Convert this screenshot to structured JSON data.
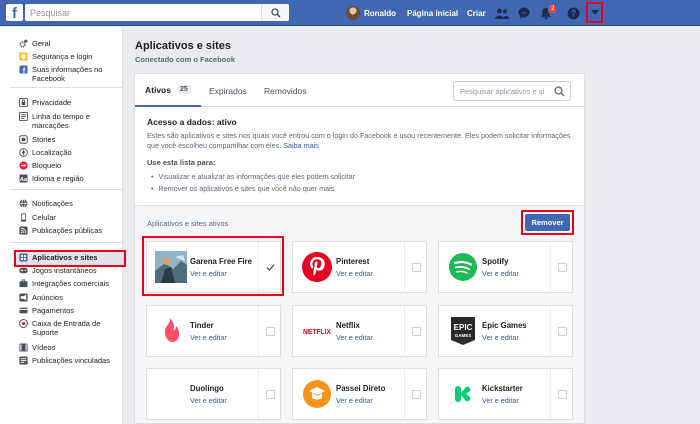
{
  "header": {
    "logo": "f",
    "search_placeholder": "Pesquisar",
    "user_name": "Ronaldo",
    "home": "Página inicial",
    "create": "Criar",
    "notification_count": "2"
  },
  "sidebar": {
    "groups": [
      [
        {
          "label": "Geral",
          "icon": "gear-icon"
        },
        {
          "label": "Segurança e login",
          "icon": "shield-icon"
        },
        {
          "label": "Suas informações no Facebook",
          "icon": "facebook-icon"
        }
      ],
      [
        {
          "label": "Privacidade",
          "icon": "lock-icon"
        },
        {
          "label": "Linha do tempo e marcações",
          "icon": "timeline-icon"
        },
        {
          "label": "Stories",
          "icon": "stories-icon"
        },
        {
          "label": "Localização",
          "icon": "location-icon"
        },
        {
          "label": "Bloqueio",
          "icon": "block-icon"
        },
        {
          "label": "Idioma e região",
          "icon": "language-icon"
        }
      ],
      [
        {
          "label": "Notificações",
          "icon": "globe-icon"
        },
        {
          "label": "Celular",
          "icon": "phone-icon"
        },
        {
          "label": "Publicações públicas",
          "icon": "rss-icon"
        }
      ],
      [
        {
          "label": "Aplicativos e sites",
          "icon": "apps-icon"
        },
        {
          "label": "Jogos instantâneos",
          "icon": "games-icon"
        },
        {
          "label": "Integrações comerciais",
          "icon": "business-icon"
        },
        {
          "label": "Anúncios",
          "icon": "ads-icon"
        },
        {
          "label": "Pagamentos",
          "icon": "payment-icon"
        },
        {
          "label": "Caixa de Entrada de Suporte",
          "icon": "support-icon"
        },
        {
          "label": "Vídeos",
          "icon": "video-icon"
        },
        {
          "label": "Publicações vinculadas",
          "icon": "linked-icon"
        }
      ]
    ]
  },
  "main": {
    "title": "Aplicativos e sites",
    "subtitle": "Conectado com o Facebook",
    "tabs": [
      {
        "label": "Ativos",
        "count": "25"
      },
      {
        "label": "Expirados"
      },
      {
        "label": "Removidos"
      }
    ],
    "search_placeholder": "Pesquisar aplicativos e si",
    "access_title": "Acesso a dados: ativo",
    "access_desc": "Estes são aplicativos e sites nos quais você entrou com o login do Facebook e usou recentemente. Eles podem solicitar informações que você escolheu compartilhar com eles.",
    "access_link": "Saiba mais",
    "use_title": "Use esta lista para:",
    "use_items": [
      "Visualizar e atualizar as informações que eles podem solicitar",
      "Remover os aplicativos e sites que você não quer mais"
    ],
    "active_header": "Aplicativos e sites ativos",
    "remove_label": "Remover",
    "edit_label": "Ver e editar",
    "apps": [
      {
        "name": "Garena Free Fire",
        "checked": true
      },
      {
        "name": "Pinterest",
        "checked": false
      },
      {
        "name": "Spotify",
        "checked": false
      },
      {
        "name": "Tinder",
        "checked": false
      },
      {
        "name": "Netflix",
        "checked": false
      },
      {
        "name": "Epic Games",
        "checked": false
      },
      {
        "name": "Duolingo",
        "checked": false
      },
      {
        "name": "Passei Direto",
        "checked": false
      },
      {
        "name": "Kickstarter",
        "checked": false
      }
    ],
    "icon_text": {
      "netflix": "NETFLIX",
      "epic": "EPIC GAMES"
    }
  },
  "colors": {
    "brand": "#4267b2",
    "highlight": "#e8001c",
    "link": "#385898"
  }
}
